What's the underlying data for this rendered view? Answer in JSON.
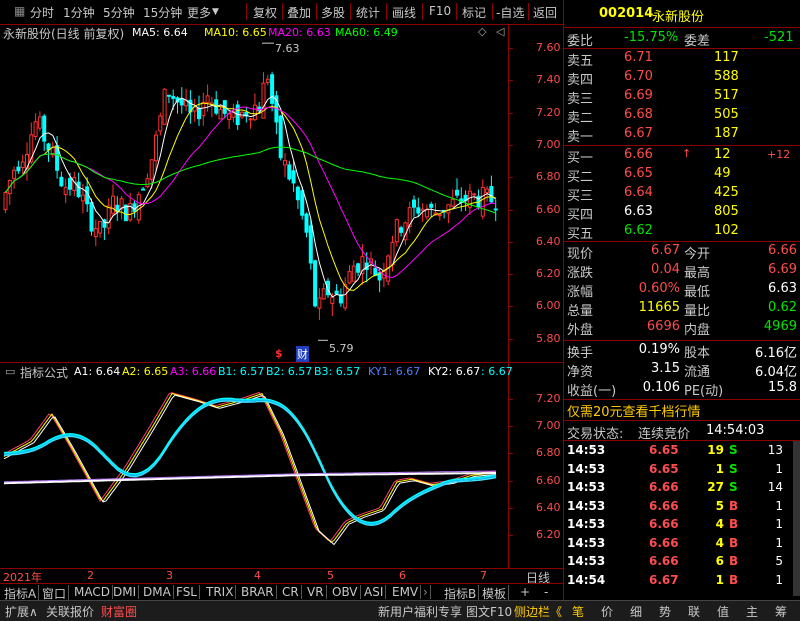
{
  "toolbar": {
    "left": [
      "分时",
      "1分钟",
      "5分钟",
      "15分钟",
      "更多"
    ],
    "right": [
      "复权",
      "叠加",
      "多股",
      "统计",
      "画线",
      "F10",
      "标记",
      "-自选",
      "返回"
    ]
  },
  "kline": {
    "title": "永新股份(日线 前复权)",
    "ma5_label": "MA5: 6.64",
    "ma10_label": "MA10: 6.65",
    "ma20_label": "MA20: 6.63",
    "ma60_label": "MA60: 6.49",
    "high_mark": "7.63",
    "low_mark": "5.79",
    "yticks": [
      "7.60",
      "7.40",
      "7.20",
      "7.00",
      "6.80",
      "6.60",
      "6.40",
      "6.20",
      "6.00",
      "5.80"
    ],
    "marker_s": "$",
    "marker_cai": "财",
    "colors": {
      "ma5": "#ffffff",
      "ma10": "#ffff00",
      "ma20": "#ff00ff",
      "ma60": "#00ff00",
      "up": "#ff3030",
      "down": "#00ffff"
    }
  },
  "indicator": {
    "name": "指标公式",
    "labels": [
      "A1: 6.64",
      "A2: 6.65",
      "A3: 6.66",
      "B1: 6.57",
      "B2: 6.57",
      "B3: 6.57",
      "KY1: 6.67",
      "KY2: 6.67",
      ": 6.67"
    ],
    "yticks": [
      "7.20",
      "7.00",
      "6.80",
      "6.60",
      "6.40",
      "6.20"
    ]
  },
  "dates": {
    "year": "2021年",
    "months": [
      "2",
      "3",
      "4",
      "5",
      "6",
      "7"
    ],
    "period": "日线"
  },
  "indicator_tabs": [
    "指标A",
    "窗口",
    "MACD",
    "DMI",
    "DMA",
    "FSL",
    "TRIX",
    "BRAR",
    "CR",
    "VR",
    "OBV",
    "ASI",
    "EMV"
  ],
  "indicator_tabs_right": [
    "指标B",
    "模板",
    "+",
    "-"
  ],
  "status": {
    "left": [
      "扩展∧",
      "关联报价",
      "财富圈"
    ],
    "promo": "新用户福利专享",
    "f10": "图文F10",
    "side": "侧边栏《",
    "right": [
      "笔",
      "价",
      "细",
      "势",
      "联",
      "值",
      "主",
      "筹"
    ]
  },
  "quote": {
    "code": "002014",
    "name": "永新股份",
    "weibi_label": "委比",
    "weibi": "-15.75%",
    "weicha_label": "委差",
    "weicha": "-521",
    "asks": [
      {
        "label": "卖五",
        "price": "6.71",
        "vol": "117"
      },
      {
        "label": "卖四",
        "price": "6.70",
        "vol": "588"
      },
      {
        "label": "卖三",
        "price": "6.69",
        "vol": "517"
      },
      {
        "label": "卖二",
        "price": "6.68",
        "vol": "505"
      },
      {
        "label": "卖一",
        "price": "6.67",
        "vol": "187"
      }
    ],
    "bids": [
      {
        "label": "买一",
        "price": "6.66",
        "vol": "12",
        "chg": "+12",
        "arrow": "↑"
      },
      {
        "label": "买二",
        "price": "6.65",
        "vol": "49",
        "chg": ""
      },
      {
        "label": "买三",
        "price": "6.64",
        "vol": "425",
        "chg": ""
      },
      {
        "label": "买四",
        "price": "6.63",
        "vol": "805",
        "chg": ""
      },
      {
        "label": "买五",
        "price": "6.62",
        "vol": "102",
        "chg": ""
      }
    ],
    "stats": [
      {
        "l1": "现价",
        "v1": "6.67",
        "l2": "今开",
        "v2": "6.66"
      },
      {
        "l1": "涨跌",
        "v1": "0.04",
        "l2": "最高",
        "v2": "6.69"
      },
      {
        "l1": "涨幅",
        "v1": "0.60%",
        "l2": "最低",
        "v2": "6.63"
      },
      {
        "l1": "总量",
        "v1": "11665",
        "l2": "量比",
        "v2": "0.62"
      },
      {
        "l1": "外盘",
        "v1": "6696",
        "l2": "内盘",
        "v2": "4969"
      }
    ],
    "stats2": [
      {
        "l1": "换手",
        "v1": "0.19%",
        "l2": "股本",
        "v2": "6.16亿"
      },
      {
        "l1": "净资",
        "v1": "3.15",
        "l2": "流通",
        "v2": "6.04亿"
      },
      {
        "l1": "收益(一)",
        "v1": "0.106",
        "l2": "PE(动)",
        "v2": "15.8"
      }
    ],
    "promo": "仅需20元查看千档行情",
    "trade_state_label": "交易状态:",
    "trade_state": "连续竞价",
    "trade_time": "14:54:03",
    "ticks": [
      {
        "t": "14:53",
        "p": "6.65",
        "v": "19",
        "bs": "S",
        "n": "13"
      },
      {
        "t": "14:53",
        "p": "6.65",
        "v": "1",
        "bs": "S",
        "n": "1"
      },
      {
        "t": "14:53",
        "p": "6.66",
        "v": "27",
        "bs": "S",
        "n": "14"
      },
      {
        "t": "14:53",
        "p": "6.66",
        "v": "5",
        "bs": "B",
        "n": "1"
      },
      {
        "t": "14:53",
        "p": "6.66",
        "v": "4",
        "bs": "B",
        "n": "1"
      },
      {
        "t": "14:53",
        "p": "6.66",
        "v": "4",
        "bs": "B",
        "n": "1"
      },
      {
        "t": "14:53",
        "p": "6.66",
        "v": "6",
        "bs": "B",
        "n": "5"
      },
      {
        "t": "14:54",
        "p": "6.67",
        "v": "1",
        "bs": "B",
        "n": "1"
      }
    ]
  }
}
